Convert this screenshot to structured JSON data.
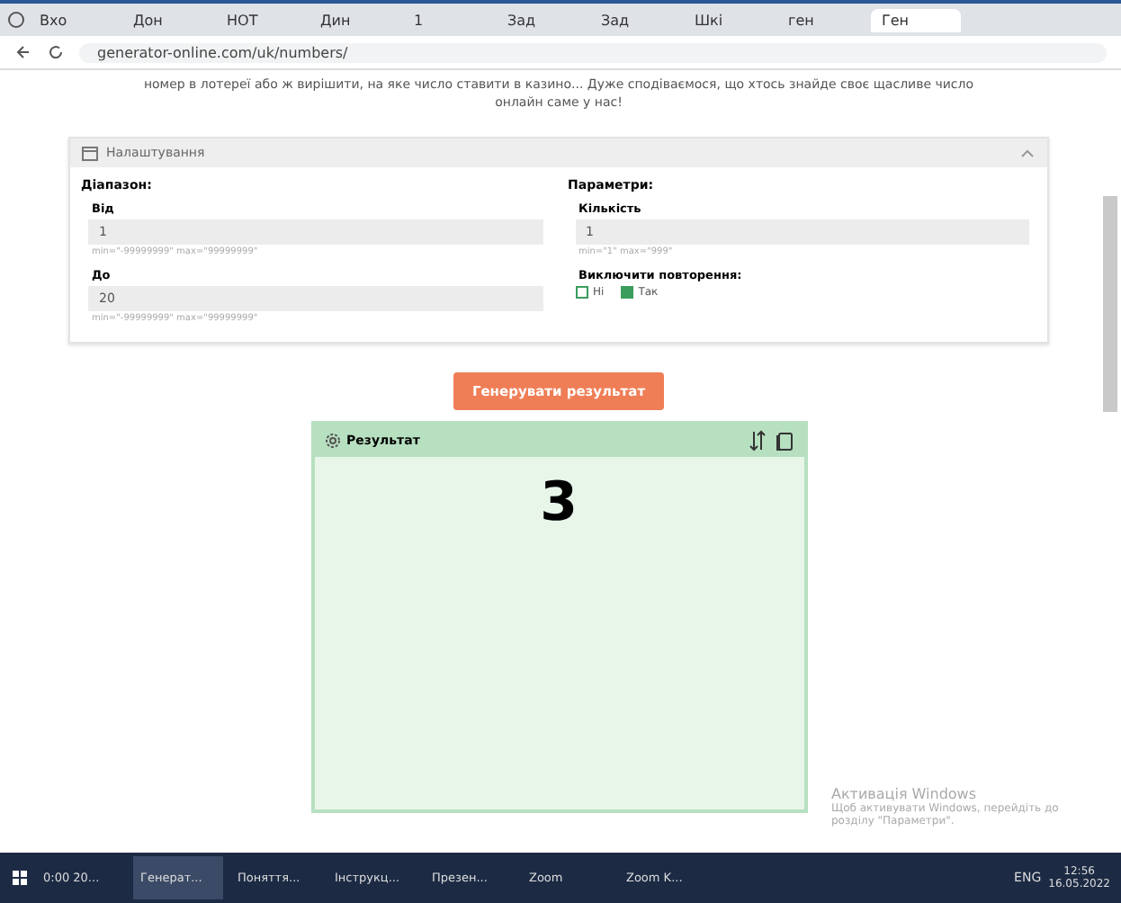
{
  "browser": {
    "tabs": [
      {
        "title": "Вхо",
        "selected": false
      },
      {
        "title": "Дон",
        "selected": false
      },
      {
        "title": "НОТ",
        "selected": false
      },
      {
        "title": "Дин",
        "selected": false
      },
      {
        "title": "1",
        "selected": false
      },
      {
        "title": "Зад",
        "selected": false
      },
      {
        "title": "Зад",
        "selected": false
      },
      {
        "title": "Шкі",
        "selected": false
      },
      {
        "title": "ген",
        "selected": false
      },
      {
        "title": "Ген",
        "selected": true
      }
    ],
    "url": "generator-online.com/uk/numbers/"
  },
  "intro": "номер в лотереї або ж вирішити, на яке число ставити в казино... Дуже сподіваємося, що хтось знайде своє щасливе число онлайн саме у нас!",
  "settings": {
    "title": "Налаштування",
    "expanded": true,
    "range": {
      "heading": "Діапазон:",
      "fields": [
        {
          "label": "Від",
          "value": "1",
          "hint": "min=\"-99999999\" max=\"99999999\""
        },
        {
          "label": "До",
          "value": "20",
          "hint": "min=\"-99999999\" max=\"99999999\""
        }
      ]
    },
    "params": {
      "heading": "Параметри:",
      "count": {
        "label": "Кількість",
        "value": "1",
        "hint": "min=\"1\" max=\"999\""
      },
      "repeat_label": "Виключити повторення:",
      "options": [
        {
          "label": "Ні",
          "selected": false
        },
        {
          "label": "Так",
          "selected": true
        }
      ]
    }
  },
  "generate_button": "Генерувати результат",
  "result": {
    "title": "Результат",
    "value": "3"
  },
  "activation": {
    "title": "Активація Windows",
    "text": "Щоб активувати Windows, перейдіть до розділу \"Параметри\"."
  },
  "taskbar": {
    "items": [
      {
        "label": "0:00 20...",
        "active": false
      },
      {
        "label": "Генерат...",
        "active": true
      },
      {
        "label": "Поняття...",
        "active": false
      },
      {
        "label": "Інструкц...",
        "active": false
      },
      {
        "label": "Презен...",
        "active": false
      },
      {
        "label": "Zoom",
        "active": false
      },
      {
        "label": "Zoom K...",
        "active": false
      }
    ],
    "lang": "ENG",
    "time": "12:56",
    "date": "16.05.2022"
  }
}
